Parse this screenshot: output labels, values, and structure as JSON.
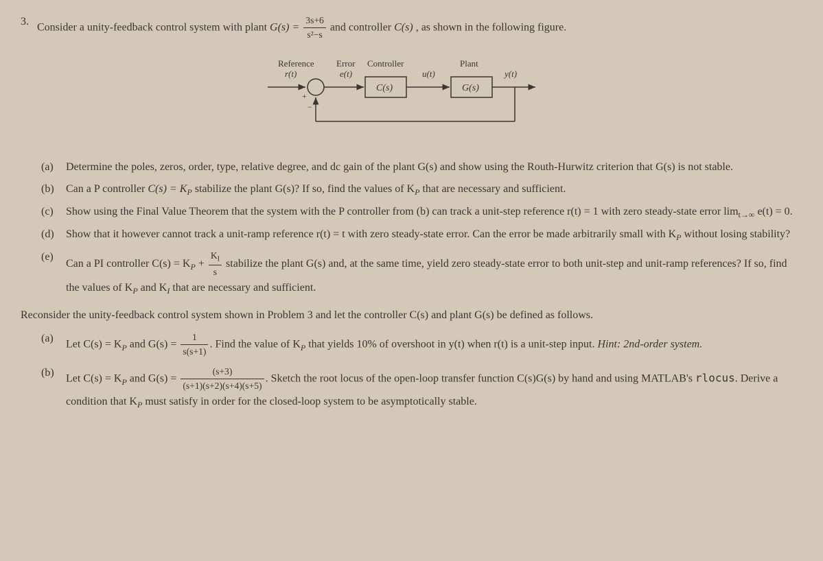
{
  "problem": {
    "number": "3.",
    "intro_p1": "Consider a unity-feedback control system with plant ",
    "intro_eq": "G(s) = ",
    "intro_frac_num": "3s+6",
    "intro_frac_den": "s²−s",
    "intro_p2": " and controller ",
    "intro_p3": "C(s)",
    "intro_p4": ", as shown in the following figure."
  },
  "diagram": {
    "reference": "Reference",
    "r_t": "r(t)",
    "error": "Error",
    "e_t": "e(t)",
    "controller": "Controller",
    "C_s": "C(s)",
    "u_t": "u(t)",
    "plant": "Plant",
    "G_s": "G(s)",
    "y_t": "y(t)",
    "plus": "+",
    "minus": "−"
  },
  "parts": {
    "a": {
      "label": "(a)",
      "text": "Determine the poles, zeros, order, type, relative degree, and dc gain of the plant G(s) and show using the Routh-Hurwitz criterion that G(s) is not stable."
    },
    "b": {
      "label": "(b)",
      "t1": "Can a P controller ",
      "eq": "C(s) = K",
      "sub": "P",
      "t2": " stabilize the plant G(s)? If so, find the values of K",
      "t3": " that are necessary and sufficient."
    },
    "c": {
      "label": "(c)",
      "t1": "Show using the Final Value Theorem that the system with the P controller from (b) can track a unit-step reference r(t) = 1 with zero steady-state error lim",
      "sub1": "t→∞",
      "t2": " e(t) = 0."
    },
    "d": {
      "label": "(d)",
      "t1": "Show that it however cannot track a unit-ramp reference r(t) = t with zero steady-state error. Can the error be made arbitrarily small with K",
      "sub": "P",
      "t2": " without losing stability?"
    },
    "e": {
      "label": "(e)",
      "t1": "Can a PI controller C(s) = K",
      "sub1": "P",
      "t2": " + ",
      "frac_num": "K",
      "frac_sub": "I",
      "frac_den": "s",
      "t3": " stabilize the plant G(s) and, at the same time, yield zero steady-state error to both unit-step and unit-ramp references? If so, find the values of K",
      "sub2": "P",
      "t4": " and K",
      "sub3": "I",
      "t5": " that are necessary and sufficient."
    }
  },
  "reconsider": {
    "text": "Reconsider the unity-feedback control system shown in Problem 3 and let the controller C(s) and plant G(s) be defined as follows."
  },
  "parts2": {
    "a": {
      "label": "(a)",
      "t1": "Let C(s) = K",
      "sub1": "P",
      "t2": " and G(s) = ",
      "frac_num": "1",
      "frac_den": "s(s+1)",
      "t3": ". Find the value of K",
      "sub2": "P",
      "t4": " that yields 10% of overshoot in y(t) when r(t) is a unit-step input. ",
      "hint": "Hint: 2nd-order system."
    },
    "b": {
      "label": "(b)",
      "t1": "Let C(s) = K",
      "sub1": "P",
      "t2": " and G(s) = ",
      "frac_num": "(s+3)",
      "frac_den": "(s+1)(s+2)(s+4)(s+5)",
      "t3": ". Sketch the root locus of the open-loop transfer function C(s)G(s) by hand and using MATLAB's ",
      "code": "rlocus",
      "t4": ". Derive a condition that K",
      "sub2": "P",
      "t5": " must satisfy in order for the closed-loop system to be asymptotically stable."
    }
  }
}
